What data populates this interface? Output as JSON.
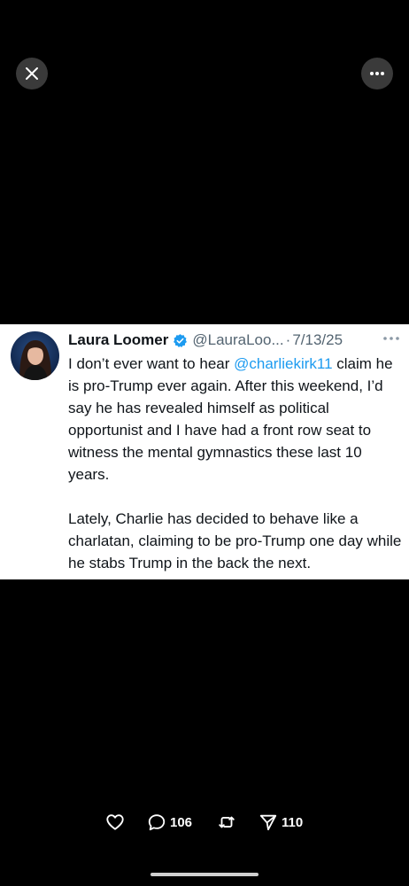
{
  "header": {
    "close_icon": "close-icon",
    "more_icon": "more-horizontal-icon"
  },
  "tweet": {
    "display_name": "Laura Loomer",
    "verified": true,
    "verified_color": "#1d9bf0",
    "handle": "@LauraLoo...",
    "separator": "·",
    "date": "7/13/25",
    "para1_before": "I don’t ever want to hear ",
    "mention": "@charliekirk11",
    "para1_after": " claim he is pro-Trump ever again. After this weekend, I’d say he has revealed himself as political opportunist and I have had a front row seat to witness the mental gymnastics these last 10 years.",
    "para2": "Lately, Charlie has decided to behave like a charlatan, claiming to be pro-Trump one day while he stabs Trump in the back the next."
  },
  "actions": {
    "like_icon": "heart-icon",
    "reply_icon": "comment-icon",
    "reply_count": "106",
    "retweet_icon": "retweet-icon",
    "share_icon": "share-icon",
    "share_count": "110"
  },
  "colors": {
    "background": "#000000",
    "card": "#ffffff",
    "text": "#0f1419",
    "muted": "#536471",
    "link": "#1d9bf0"
  }
}
